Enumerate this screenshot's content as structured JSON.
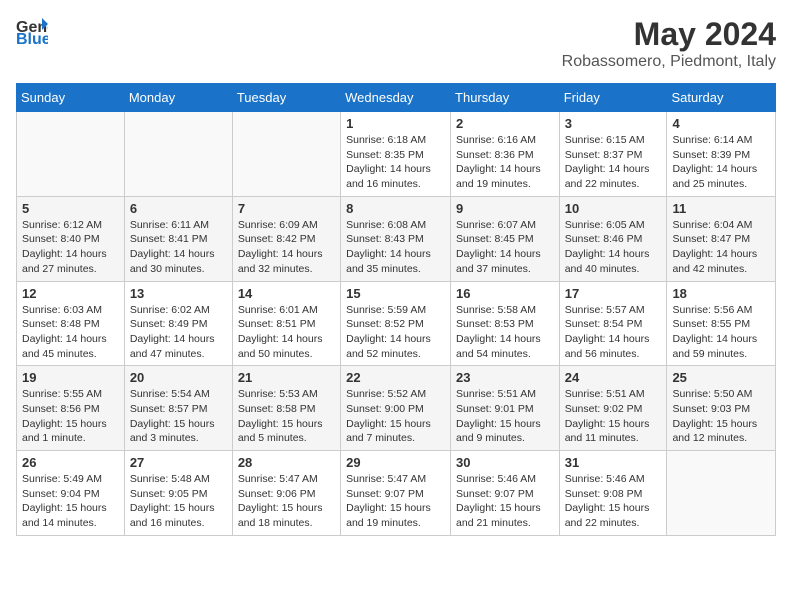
{
  "header": {
    "logo_general": "General",
    "logo_blue": "Blue",
    "month_year": "May 2024",
    "location": "Robassomero, Piedmont, Italy"
  },
  "weekdays": [
    "Sunday",
    "Monday",
    "Tuesday",
    "Wednesday",
    "Thursday",
    "Friday",
    "Saturday"
  ],
  "weeks": [
    [
      {
        "day": "",
        "info": ""
      },
      {
        "day": "",
        "info": ""
      },
      {
        "day": "",
        "info": ""
      },
      {
        "day": "1",
        "info": "Sunrise: 6:18 AM\nSunset: 8:35 PM\nDaylight: 14 hours\nand 16 minutes."
      },
      {
        "day": "2",
        "info": "Sunrise: 6:16 AM\nSunset: 8:36 PM\nDaylight: 14 hours\nand 19 minutes."
      },
      {
        "day": "3",
        "info": "Sunrise: 6:15 AM\nSunset: 8:37 PM\nDaylight: 14 hours\nand 22 minutes."
      },
      {
        "day": "4",
        "info": "Sunrise: 6:14 AM\nSunset: 8:39 PM\nDaylight: 14 hours\nand 25 minutes."
      }
    ],
    [
      {
        "day": "5",
        "info": "Sunrise: 6:12 AM\nSunset: 8:40 PM\nDaylight: 14 hours\nand 27 minutes."
      },
      {
        "day": "6",
        "info": "Sunrise: 6:11 AM\nSunset: 8:41 PM\nDaylight: 14 hours\nand 30 minutes."
      },
      {
        "day": "7",
        "info": "Sunrise: 6:09 AM\nSunset: 8:42 PM\nDaylight: 14 hours\nand 32 minutes."
      },
      {
        "day": "8",
        "info": "Sunrise: 6:08 AM\nSunset: 8:43 PM\nDaylight: 14 hours\nand 35 minutes."
      },
      {
        "day": "9",
        "info": "Sunrise: 6:07 AM\nSunset: 8:45 PM\nDaylight: 14 hours\nand 37 minutes."
      },
      {
        "day": "10",
        "info": "Sunrise: 6:05 AM\nSunset: 8:46 PM\nDaylight: 14 hours\nand 40 minutes."
      },
      {
        "day": "11",
        "info": "Sunrise: 6:04 AM\nSunset: 8:47 PM\nDaylight: 14 hours\nand 42 minutes."
      }
    ],
    [
      {
        "day": "12",
        "info": "Sunrise: 6:03 AM\nSunset: 8:48 PM\nDaylight: 14 hours\nand 45 minutes."
      },
      {
        "day": "13",
        "info": "Sunrise: 6:02 AM\nSunset: 8:49 PM\nDaylight: 14 hours\nand 47 minutes."
      },
      {
        "day": "14",
        "info": "Sunrise: 6:01 AM\nSunset: 8:51 PM\nDaylight: 14 hours\nand 50 minutes."
      },
      {
        "day": "15",
        "info": "Sunrise: 5:59 AM\nSunset: 8:52 PM\nDaylight: 14 hours\nand 52 minutes."
      },
      {
        "day": "16",
        "info": "Sunrise: 5:58 AM\nSunset: 8:53 PM\nDaylight: 14 hours\nand 54 minutes."
      },
      {
        "day": "17",
        "info": "Sunrise: 5:57 AM\nSunset: 8:54 PM\nDaylight: 14 hours\nand 56 minutes."
      },
      {
        "day": "18",
        "info": "Sunrise: 5:56 AM\nSunset: 8:55 PM\nDaylight: 14 hours\nand 59 minutes."
      }
    ],
    [
      {
        "day": "19",
        "info": "Sunrise: 5:55 AM\nSunset: 8:56 PM\nDaylight: 15 hours\nand 1 minute."
      },
      {
        "day": "20",
        "info": "Sunrise: 5:54 AM\nSunset: 8:57 PM\nDaylight: 15 hours\nand 3 minutes."
      },
      {
        "day": "21",
        "info": "Sunrise: 5:53 AM\nSunset: 8:58 PM\nDaylight: 15 hours\nand 5 minutes."
      },
      {
        "day": "22",
        "info": "Sunrise: 5:52 AM\nSunset: 9:00 PM\nDaylight: 15 hours\nand 7 minutes."
      },
      {
        "day": "23",
        "info": "Sunrise: 5:51 AM\nSunset: 9:01 PM\nDaylight: 15 hours\nand 9 minutes."
      },
      {
        "day": "24",
        "info": "Sunrise: 5:51 AM\nSunset: 9:02 PM\nDaylight: 15 hours\nand 11 minutes."
      },
      {
        "day": "25",
        "info": "Sunrise: 5:50 AM\nSunset: 9:03 PM\nDaylight: 15 hours\nand 12 minutes."
      }
    ],
    [
      {
        "day": "26",
        "info": "Sunrise: 5:49 AM\nSunset: 9:04 PM\nDaylight: 15 hours\nand 14 minutes."
      },
      {
        "day": "27",
        "info": "Sunrise: 5:48 AM\nSunset: 9:05 PM\nDaylight: 15 hours\nand 16 minutes."
      },
      {
        "day": "28",
        "info": "Sunrise: 5:47 AM\nSunset: 9:06 PM\nDaylight: 15 hours\nand 18 minutes."
      },
      {
        "day": "29",
        "info": "Sunrise: 5:47 AM\nSunset: 9:07 PM\nDaylight: 15 hours\nand 19 minutes."
      },
      {
        "day": "30",
        "info": "Sunrise: 5:46 AM\nSunset: 9:07 PM\nDaylight: 15 hours\nand 21 minutes."
      },
      {
        "day": "31",
        "info": "Sunrise: 5:46 AM\nSunset: 9:08 PM\nDaylight: 15 hours\nand 22 minutes."
      },
      {
        "day": "",
        "info": ""
      }
    ]
  ]
}
